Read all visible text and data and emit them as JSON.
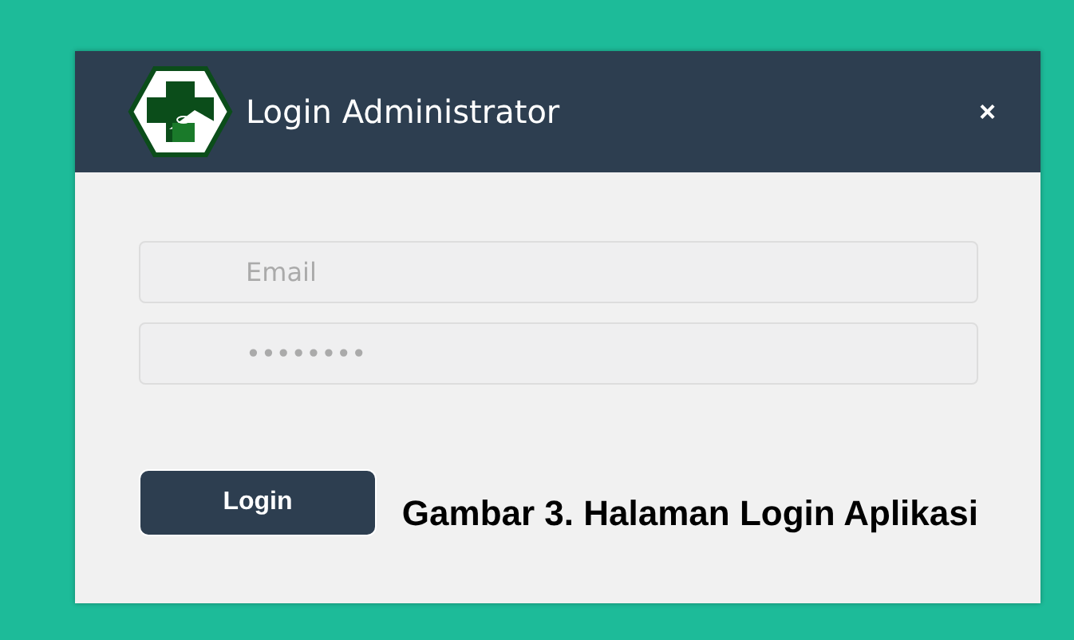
{
  "dialog": {
    "title": "Login Administrator",
    "close": "×"
  },
  "fields": [
    {
      "placeholder": "Email"
    },
    {
      "placeholder": "••••••••"
    }
  ],
  "button": "Login",
  "caption": "Gambar 3. Halaman Login Aplikasi"
}
